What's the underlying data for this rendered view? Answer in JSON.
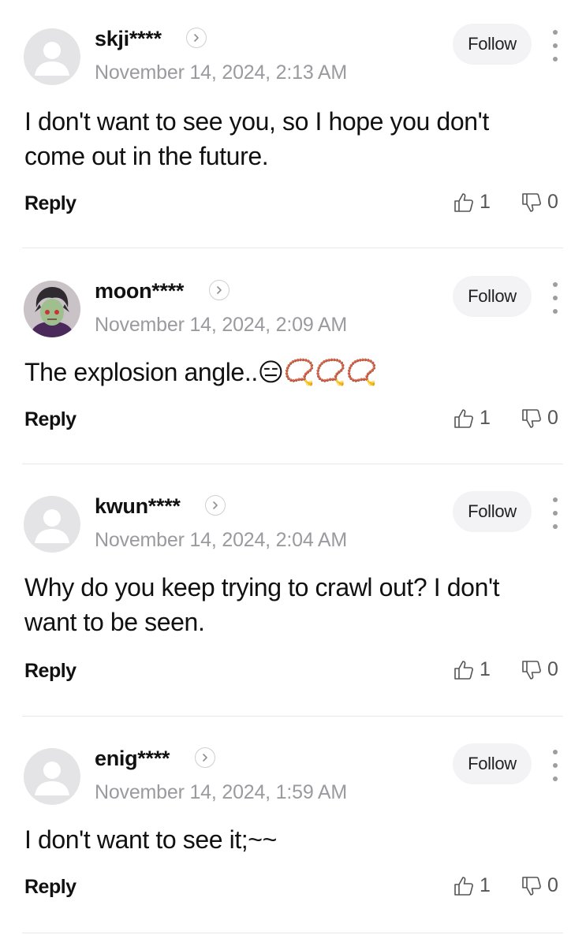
{
  "comments": [
    {
      "username": "skji****",
      "date": "November 14, 2024, 2:13 AM",
      "text_lines": [
        "I don't want to see you, so I hope you don't",
        "come out in the future."
      ],
      "follow_label": "Follow",
      "reply_label": "Reply",
      "likes": "1",
      "dislikes": "0",
      "avatar": "default-avatar-icon"
    },
    {
      "username": "moon****",
      "date": "November 14, 2024, 2:09 AM",
      "text_lines": [
        "The explosion angle..😑📿📿📿"
      ],
      "follow_label": "Follow",
      "reply_label": "Reply",
      "likes": "1",
      "dislikes": "0",
      "avatar": "character-avatar"
    },
    {
      "username": "kwun****",
      "date": "November 14, 2024, 2:04 AM",
      "text_lines": [
        "Why do you keep trying to crawl out? I don't",
        "want to be seen."
      ],
      "follow_label": "Follow",
      "reply_label": "Reply",
      "likes": "1",
      "dislikes": "0",
      "avatar": "default-avatar-icon"
    },
    {
      "username": "enig****",
      "date": "November 14, 2024, 1:59 AM",
      "text_lines": [
        "I don't want to see it;~~"
      ],
      "follow_label": "Follow",
      "reply_label": "Reply",
      "likes": "1",
      "dislikes": "0",
      "avatar": "default-avatar-icon"
    }
  ],
  "colors": {
    "text": "#111111",
    "muted": "#9a9a9f",
    "follow_bg": "#f3f3f6",
    "divider": "#e8e8ea"
  }
}
